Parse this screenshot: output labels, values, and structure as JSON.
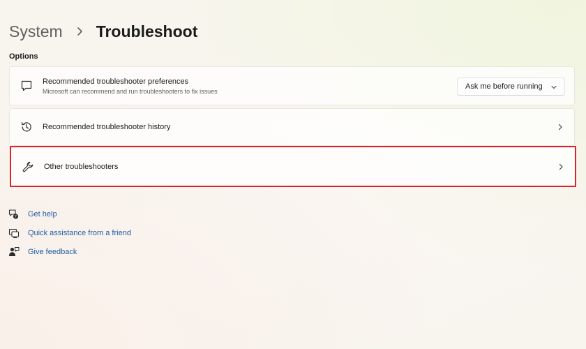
{
  "breadcrumb": {
    "parent": "System",
    "current": "Troubleshoot"
  },
  "options": {
    "section_label": "Options",
    "cards": [
      {
        "icon": "chat-bubble-icon",
        "title": "Recommended troubleshooter preferences",
        "subtitle": "Microsoft can recommend and run troubleshooters to fix issues",
        "dropdown_value": "Ask me before running"
      },
      {
        "icon": "history-icon",
        "title": "Recommended troubleshooter history"
      },
      {
        "icon": "wrench-icon",
        "title": "Other troubleshooters",
        "highlighted": true,
        "highlight_color": "#e0202c"
      }
    ]
  },
  "help_links": [
    {
      "icon": "help-chat-icon",
      "label": "Get help"
    },
    {
      "icon": "remote-assist-icon",
      "label": "Quick assistance from a friend"
    },
    {
      "icon": "feedback-icon",
      "label": "Give feedback"
    }
  ],
  "colors": {
    "link": "#1f5da3",
    "highlight": "#e0202c"
  }
}
